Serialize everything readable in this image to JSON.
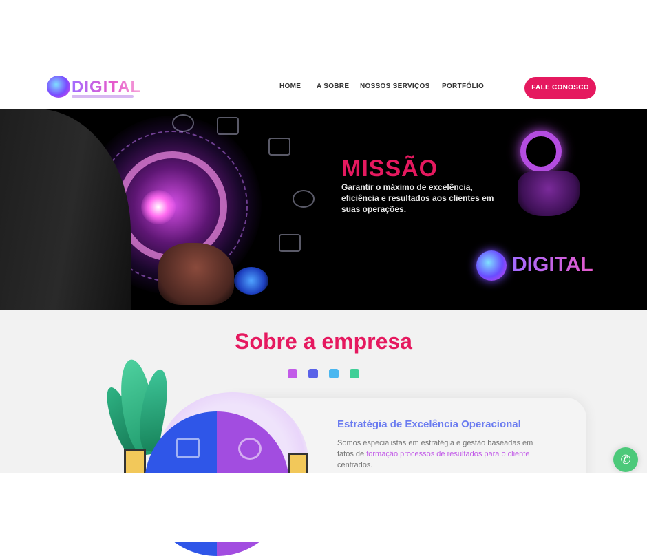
{
  "brand": {
    "logo_text": "DIGITAL",
    "colors": {
      "accent": "#e5195f",
      "purple": "#c25be8",
      "blue": "#5a62e8",
      "cyan": "#4ab7f0",
      "green": "#3fcf97"
    }
  },
  "nav": {
    "items": [
      {
        "label": "HOME"
      },
      {
        "label": "A SOBRE"
      },
      {
        "label": "NOSSOS SERVIÇOS"
      },
      {
        "label": "PORTFÓLIO"
      }
    ],
    "cta_label": "FALE CONOSCO"
  },
  "hero": {
    "title": "MISSÃO",
    "text": "Garantir o máximo de excelência, eficiência e resultados aos clientes em suas operações.",
    "neon_logo_text": "DIGITAL"
  },
  "about": {
    "title": "Sobre a empresa",
    "card": {
      "title": "Estratégia de Excelência Operacional",
      "text_before": "Somos especialistas em estratégia e gestão baseadas em fatos de ",
      "text_highlight": "formação processos de resultados para o cliente",
      "text_after": " centrados."
    }
  },
  "icons": {
    "whatsapp": "whatsapp-icon",
    "power": "power-icon"
  }
}
